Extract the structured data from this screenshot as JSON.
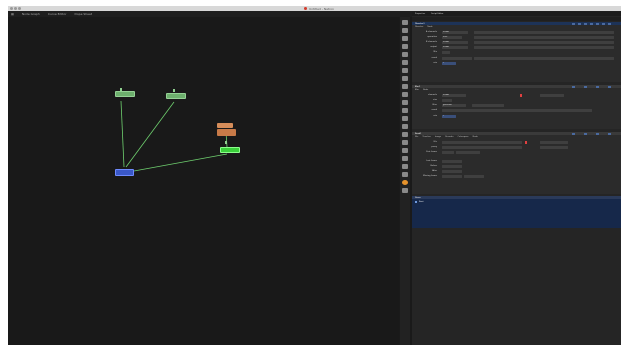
{
  "window": {
    "title": "Untitled - Natron",
    "title_dot_color": "#d33b2c"
  },
  "menubar": {
    "icon": "nodegraph-menu-icon",
    "items": [
      "Node Graph",
      "Curve Editor",
      "Dope Sheet"
    ]
  },
  "nodegraph": {
    "nodes": [
      {
        "id": "read-a",
        "color": "green",
        "label": ""
      },
      {
        "id": "read-b",
        "color": "green",
        "label": ""
      },
      {
        "id": "op-orange-a",
        "color": "orange",
        "label": ""
      },
      {
        "id": "op-orange-b",
        "color": "orange",
        "label": ""
      },
      {
        "id": "viewer",
        "color": "blue",
        "label": ""
      },
      {
        "id": "selected",
        "color": "bright-green",
        "label": ""
      }
    ]
  },
  "toolbar": {
    "tools": [
      "select-icon",
      "transform-icon",
      "paint-icon",
      "color-icon",
      "channel-icon",
      "filter-icon",
      "keyer-icon",
      "merge-icon",
      "time-icon",
      "other-icon",
      "views-icon",
      "gmic-icon",
      "extra-icon",
      "image-icon",
      "draw-icon",
      "merge2-icon",
      "grade-icon",
      "plugin-icon",
      "settings-icon",
      "info-icon",
      "favourite-icon",
      "python-icon",
      "render-icon",
      "orange-plugin-icon",
      "last-icon"
    ]
  },
  "properties": {
    "tabs": [
      "Properties",
      "Script Editor"
    ],
    "panels": [
      {
        "title": "Dissolve1",
        "tabs": [
          "Dissolve",
          "Node"
        ],
        "rows": [
          {
            "label": "A channels",
            "value": "RGBA"
          },
          {
            "label": "operation",
            "value": "over"
          },
          {
            "label": "B channels",
            "value": "RGBA"
          },
          {
            "label": "output",
            "value": "RGBA"
          },
          {
            "label": "Mix",
            "value": ""
          },
          {
            "label": "mask",
            "value": ""
          },
          {
            "label": "mix",
            "value": "1"
          }
        ]
      },
      {
        "title": "Blur1",
        "tabs": [
          "Blur",
          "Node"
        ],
        "rows": [
          {
            "label": "channels",
            "value": "RGBA"
          },
          {
            "label": "size",
            "value": ""
          },
          {
            "label": "filter",
            "value": "gaussian"
          },
          {
            "label": "mask",
            "value": ""
          },
          {
            "label": "mix",
            "value": "1"
          }
        ]
      },
      {
        "title": "Read1",
        "tabs": [
          "File",
          "Timeline",
          "Image",
          "Decoder",
          "Colorspace",
          "Node"
        ],
        "rows": [
          {
            "label": "File",
            "value": ""
          },
          {
            "label": "proxy",
            "value": ""
          },
          {
            "label": "First frame",
            "value": ""
          },
          {
            "label": "Last frame",
            "value": ""
          },
          {
            "label": "Before",
            "value": ""
          },
          {
            "label": "After",
            "value": ""
          },
          {
            "label": "Missing frame",
            "value": ""
          }
        ]
      }
    ],
    "table": {
      "headers": [
        "Name",
        "",
        "",
        "",
        "",
        "",
        ""
      ],
      "rows": [
        {
          "name": "Root"
        }
      ]
    }
  }
}
